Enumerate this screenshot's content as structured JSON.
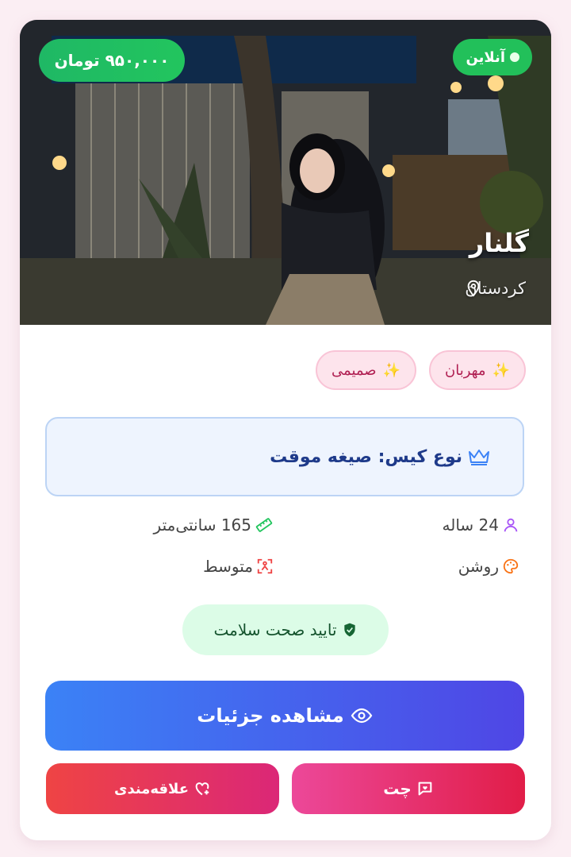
{
  "profile": {
    "status": "آنلاین",
    "price": "۹۵۰,۰۰۰ تومان",
    "name": "گلنار",
    "location": "کردستان"
  },
  "tags": [
    {
      "emoji": "✨",
      "label": "مهربان"
    },
    {
      "emoji": "✨",
      "label": "صمیمی"
    }
  ],
  "case_type": "نوع کیس: صیغه موقت",
  "stats": {
    "age": "24 ساله",
    "height": "165 سانتی‌متر",
    "skin": "روشن",
    "body": "متوسط"
  },
  "health": "تایید صحت سلامت",
  "buttons": {
    "details": "مشاهده جزئیات",
    "chat": "چت",
    "favorite": "علاقه‌مندی"
  },
  "colors": {
    "online": "#22c05a",
    "price": "#22c55e",
    "details_btn": "#4f46e5",
    "chat_btn": "#e11d48",
    "favorite_btn": "#db2777"
  }
}
